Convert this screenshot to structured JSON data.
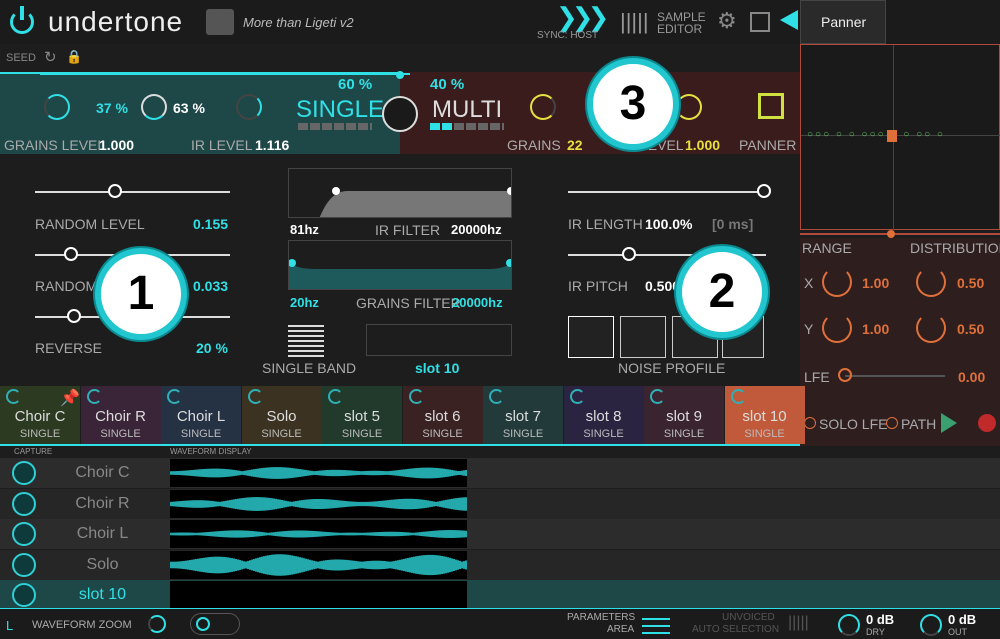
{
  "header": {
    "logo": "undertone",
    "preset": "More than Ligeti v2",
    "sync": "SYNC: HOST",
    "sample_editor_1": "SAMPLE",
    "sample_editor_2": "EDITOR",
    "panner_tab": "Panner"
  },
  "seed": {
    "label": "SEED"
  },
  "top": {
    "pct_single": "60 %",
    "pct_multi": "40 %",
    "knob1": "37 %",
    "knob2": "63 %",
    "single": "SINGLE",
    "multi": "MULTI",
    "grains_level_label": "GRAINS LEVEL",
    "grains_level": "1.000",
    "ir_level_label": "IR LEVEL",
    "ir_level": "1.116",
    "grains_label": "GRAINS",
    "grains": "22",
    "level_label": "LEVEL",
    "level": "1.000",
    "panner_label": "PANNER"
  },
  "left": {
    "random_level_label": "RANDOM LEVEL",
    "random_level": "0.155",
    "random_label": "RANDOM",
    "random": "0.033",
    "reverse_label": "REVERSE",
    "reverse": "20 %"
  },
  "mid": {
    "ir_filter_low": "81hz",
    "ir_filter_label": "IR FILTER",
    "ir_filter_high": "20000hz",
    "gf_low": "20hz",
    "gf_label": "GRAINS FILTER",
    "gf_high": "20000hz",
    "single_band": "SINGLE BAND",
    "slot": "slot 10"
  },
  "right": {
    "ir_length_label": "IR LENGTH",
    "ir_length": "100.0%",
    "ir_length_ms": "[0 ms]",
    "ir_pitch_label": "IR PITCH",
    "ir_pitch": "0.500",
    "noise_profile": "NOISE PROFILE"
  },
  "badges": {
    "b1": "1",
    "b2": "2",
    "b3": "3"
  },
  "panner": {
    "range": "RANGE",
    "distribution": "DISTRIBUTION",
    "x": "X",
    "x_val": "1.00",
    "x_dist": "0.50",
    "y": "Y",
    "y_val": "1.00",
    "y_dist": "0.50",
    "lfe": "LFE",
    "lfe_val": "0.00",
    "solo_lfe": "SOLO LFE",
    "path": "PATH"
  },
  "tabs": [
    {
      "name": "Choir C",
      "sub": "SINGLE",
      "bg": "#2c3a21"
    },
    {
      "name": "Choir R",
      "sub": "SINGLE",
      "bg": "#3a2438"
    },
    {
      "name": "Choir L",
      "sub": "SINGLE",
      "bg": "#243244"
    },
    {
      "name": "Solo",
      "sub": "SINGLE",
      "bg": "#3b3222"
    },
    {
      "name": "slot 5",
      "sub": "SINGLE",
      "bg": "#213a2c"
    },
    {
      "name": "slot 6",
      "sub": "SINGLE",
      "bg": "#3a2222"
    },
    {
      "name": "slot 7",
      "sub": "SINGLE",
      "bg": "#223a3a"
    },
    {
      "name": "slot 8",
      "sub": "SINGLE",
      "bg": "#2a2440"
    },
    {
      "name": "slot 9",
      "sub": "SINGLE",
      "bg": "#3a2430"
    },
    {
      "name": "slot 10",
      "sub": "SINGLE",
      "bg": "#c05a3a"
    }
  ],
  "capture": {
    "capture": "CAPTURE",
    "waveform": "WAVEFORM DISPLAY",
    "rows": [
      "Choir C",
      "Choir R",
      "Choir L",
      "Solo",
      "slot 10"
    ]
  },
  "footer": {
    "l": "L",
    "zoom": "WAVEFORM ZOOM",
    "params_1": "PARAMETERS",
    "params_2": "AREA",
    "unvoiced_1": "UNVOICED",
    "unvoiced_2": "AUTO SELECTION",
    "dry_val": "0 dB",
    "dry": "DRY",
    "out_val": "0 dB",
    "out": "OUT"
  }
}
